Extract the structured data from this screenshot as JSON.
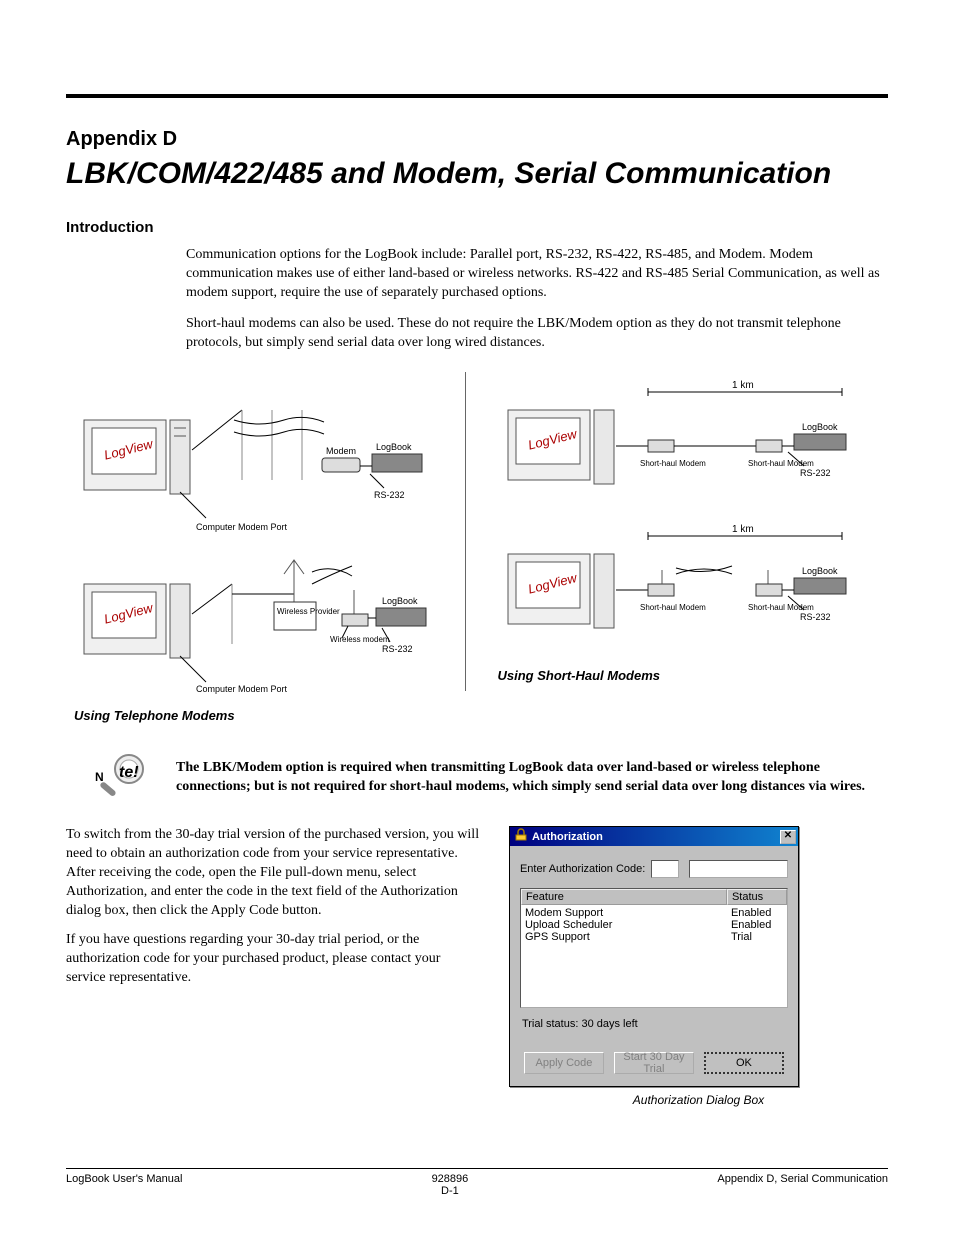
{
  "chapter": {
    "label": "Appendix D",
    "title": "LBK/COM/422/485 and Modem, Serial Communication"
  },
  "intro": {
    "heading": "Introduction",
    "para1": "Communication options for the LogBook include: Parallel port, RS-232, RS-422, RS-485, and Modem. Modem communication makes use of either land-based or wireless networks. RS-422 and RS-485 Serial Communication, as well as modem support, require the use of separately purchased options.",
    "para2": "Short-haul modems can also be used. These do not require the LBK/Modem option as they do not transmit telephone protocols, but simply send serial data over long wired distances."
  },
  "note": {
    "body": "The LBK/Modem option is required when transmitting LogBook data over land-based or wireless telephone connections; but is not required for short-haul modems, which simply send serial data over long distances via wires.",
    "image_label_left": "Using Telephone Modems",
    "image_label_right": "Using Short-Haul Modems"
  },
  "diagram_labels_left": {
    "computer_port": "Computer Modem Port",
    "modem": "Modem",
    "logbook": "LogBook",
    "rs232": "RS-232",
    "wireless_provider": "Wireless Provider",
    "wireless_modem": "Wireless modem"
  },
  "diagram_labels_right": {
    "dist": "1 km",
    "logbook": "LogBook",
    "rs232": "RS-232",
    "short_haul": "Short-haul Modem"
  },
  "auth_section": {
    "para1": "To switch from the 30-day trial version of the purchased version, you will need to obtain an authorization code from your service representative. After receiving the code, open the File pull-down menu, select Authorization, and enter the code in the text field of the Authorization dialog box, then click the Apply Code button.",
    "para2": "If you have questions regarding your 30-day trial period, or the authorization code for your purchased product, please contact your service representative."
  },
  "dialog": {
    "title": "Authorization",
    "enter_label": "Enter Authorization Code:",
    "features_header_left": "Feature",
    "features_header_right": "Status",
    "features": [
      {
        "name": "Modem Support",
        "status": "Enabled"
      },
      {
        "name": "Upload Scheduler",
        "status": "Enabled"
      },
      {
        "name": "GPS Support",
        "status": "Trial"
      }
    ],
    "trial_status": "Trial status: 30 days left",
    "buttons": {
      "apply": "Apply Code",
      "start_trial": "Start 30 Day Trial",
      "ok": "OK"
    },
    "caption": "Authorization Dialog Box"
  },
  "footer": {
    "left": "LogBook User's Manual",
    "center_line1": "928896",
    "center_line2": "D-1",
    "right": "Appendix D, Serial Communication"
  }
}
